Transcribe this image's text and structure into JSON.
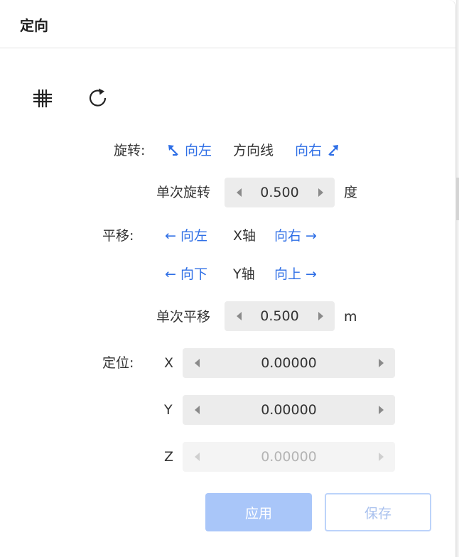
{
  "header": {
    "title": "定向"
  },
  "toolbar": {
    "grid_icon": "grid-icon",
    "reset_icon": "rotate-refresh-icon"
  },
  "rotation": {
    "label": "旋转:",
    "left_text": "向左",
    "center_text": "方向线",
    "right_text": "向右",
    "step_label": "单次旋转",
    "step_value": "0.500",
    "step_unit": "度"
  },
  "translation": {
    "label": "平移:",
    "x_left": "← 向左",
    "x_axis": "X轴",
    "x_right": "向右 →",
    "y_down": "← 向下",
    "y_axis": "Y轴",
    "y_up": "向上 →",
    "step_label": "单次平移",
    "step_value": "0.500",
    "step_unit": "m"
  },
  "position": {
    "label": "定位:",
    "x_label": "X",
    "x_value": "0.00000",
    "y_label": "Y",
    "y_value": "0.00000",
    "z_label": "Z",
    "z_value": "0.00000"
  },
  "actions": {
    "apply": "应用",
    "save": "保存"
  },
  "colors": {
    "accent": "#2f6fe6",
    "apply_bg": "#a9c6f9",
    "save_border": "#bcd3fa"
  }
}
